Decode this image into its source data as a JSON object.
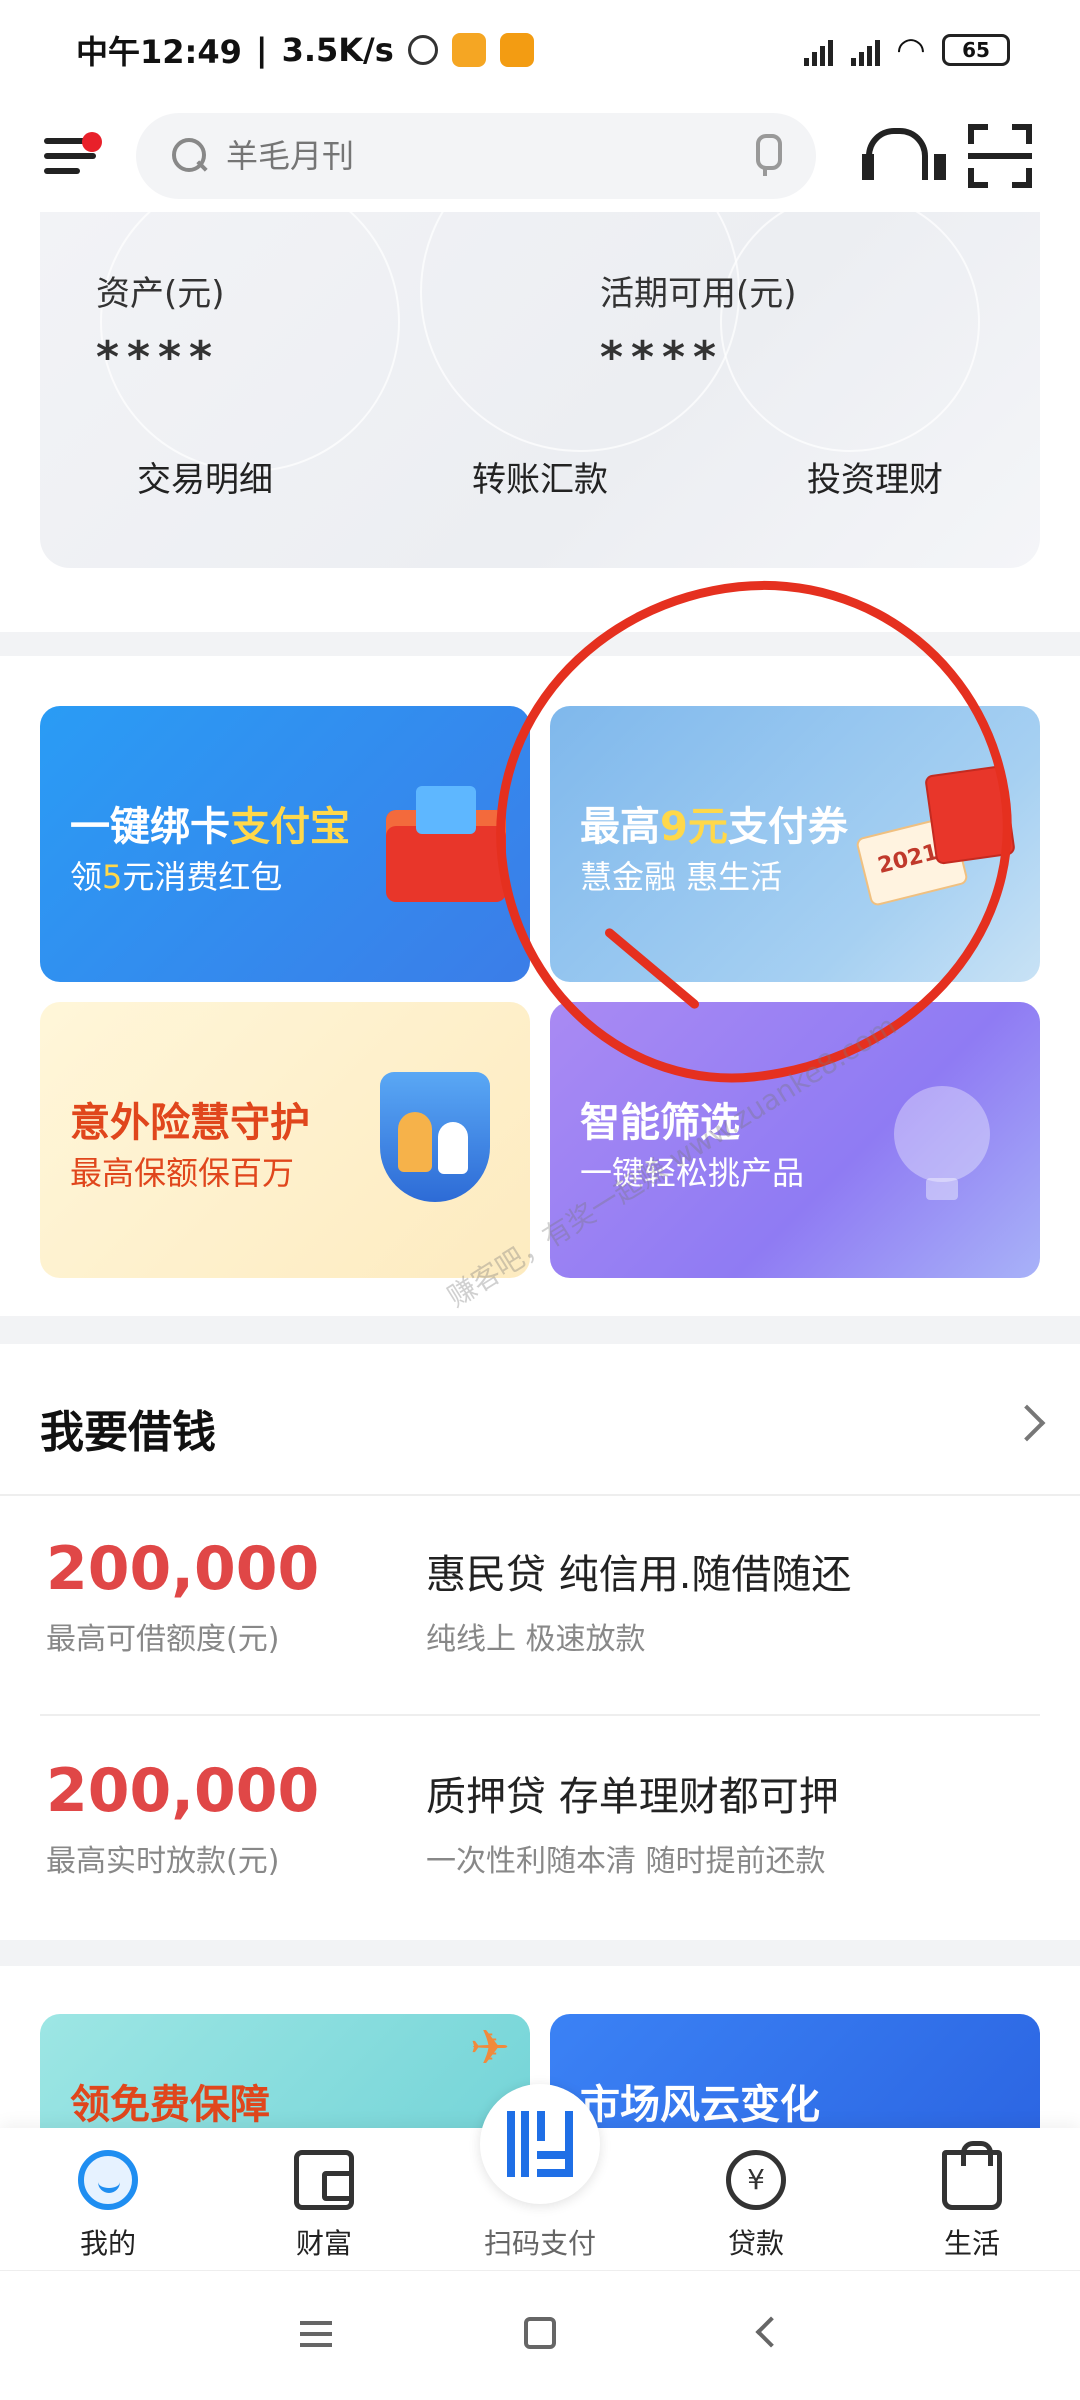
{
  "status_bar": {
    "time": "中午12:49",
    "speed": "3.5K/s",
    "battery": "65"
  },
  "header": {
    "search_placeholder": "羊毛月刊"
  },
  "asset_card": {
    "assets_label": "资产(元)",
    "assets_value": "****",
    "current_label": "活期可用(元)",
    "current_value": "****",
    "actions": [
      "交易明细",
      "转账汇款",
      "投资理财"
    ]
  },
  "promos": {
    "p1": {
      "title_a": "一键绑卡",
      "title_b": "支付宝",
      "sub_a": "领",
      "sub_b": "5",
      "sub_c": "元消费红包"
    },
    "p2": {
      "title_a": "最高",
      "title_b": "9元",
      "title_c": "支付券",
      "sub": "慧金融 惠生活",
      "year": "2021"
    },
    "p3": {
      "title": "意外险慧守护",
      "sub": "最高保额保百万"
    },
    "p4": {
      "title": "智能筛选",
      "sub": "一键轻松挑产品"
    }
  },
  "watermark": "赚客吧，有奖一起赚 www.zuanke8.com",
  "loan": {
    "title": "我要借钱",
    "rows": [
      {
        "amount": "200,000",
        "amount_label": "最高可借额度(元)",
        "name": "惠民贷 纯信用.随借随还",
        "sub": "纯线上  极速放款"
      },
      {
        "amount": "200,000",
        "amount_label": "最高实时放款(元)",
        "name": "质押贷 存单理财都可押",
        "sub": "一次性利随本清  随时提前还款"
      }
    ]
  },
  "peek": {
    "left": "领免费保障",
    "right": "市场风云变化"
  },
  "tabs": [
    {
      "label": "我的"
    },
    {
      "label": "财富"
    },
    {
      "label": "扫码支付"
    },
    {
      "label": "贷款"
    },
    {
      "label": "生活"
    }
  ],
  "colors": {
    "brand_blue": "#1f8ef1",
    "loan_red": "#e04747",
    "annotation_red": "#e5301f"
  }
}
